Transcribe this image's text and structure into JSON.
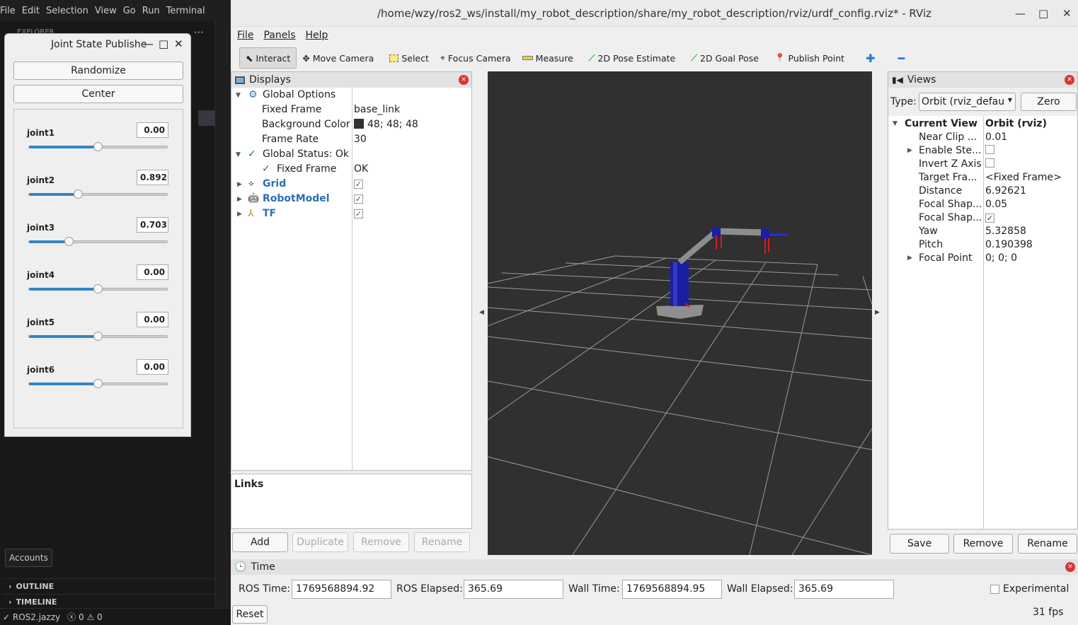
{
  "vscode": {
    "menu": [
      "File",
      "Edit",
      "Selection",
      "View",
      "Go",
      "Run",
      "Terminal"
    ],
    "explorer_label": "EXPLORER",
    "accounts_tooltip": "Accounts",
    "sections": [
      "OUTLINE",
      "TIMELINE"
    ],
    "status": {
      "branch": "ROS2.jazzy",
      "errors": "0",
      "warnings": "0"
    }
  },
  "jsp": {
    "title": "Joint State Publishe",
    "randomize": "Randomize",
    "center": "Center",
    "joints": [
      {
        "name": "joint1",
        "value": "0.00",
        "fraction": 0.5
      },
      {
        "name": "joint2",
        "value": "0.892",
        "fraction": 0.36
      },
      {
        "name": "joint3",
        "value": "0.703",
        "fraction": 0.29
      },
      {
        "name": "joint4",
        "value": "0.00",
        "fraction": 0.5
      },
      {
        "name": "joint5",
        "value": "0.00",
        "fraction": 0.5
      },
      {
        "name": "joint6",
        "value": "0.00",
        "fraction": 0.5
      }
    ]
  },
  "rviz": {
    "title": "/home/wzy/ros2_ws/install/my_robot_description/share/my_robot_description/rviz/urdf_config.rviz* - RViz",
    "menu": [
      "File",
      "Panels",
      "Help"
    ],
    "tools": [
      "Interact",
      "Move Camera",
      "Select",
      "Focus Camera",
      "Measure",
      "2D Pose Estimate",
      "2D Goal Pose",
      "Publish Point"
    ],
    "displays": {
      "title": "Displays",
      "global_options": "Global Options",
      "fixed_frame_label": "Fixed Frame",
      "fixed_frame_value": "base_link",
      "bg_color_label": "Background Color",
      "bg_color_value": "48; 48; 48",
      "frame_rate_label": "Frame Rate",
      "frame_rate_value": "30",
      "global_status": "Global Status: Ok",
      "status_fixed_frame": "Fixed Frame",
      "status_fixed_frame_value": "OK",
      "grid": "Grid",
      "robot_model": "RobotModel",
      "tf": "TF"
    },
    "links_title": "Links",
    "display_buttons": {
      "add": "Add",
      "duplicate": "Duplicate",
      "remove": "Remove",
      "rename": "Rename"
    },
    "views": {
      "title": "Views",
      "type_label": "Type:",
      "type_value": "Orbit (rviz_defau",
      "zero": "Zero",
      "current_view": "Current View",
      "current_view_value": "Orbit (rviz)",
      "props": [
        {
          "name": "Near Clip ...",
          "value": "0.01",
          "kind": "text"
        },
        {
          "name": "Enable Ste...",
          "value": "",
          "kind": "check-off",
          "expand": true
        },
        {
          "name": "Invert Z Axis",
          "value": "",
          "kind": "check-off"
        },
        {
          "name": "Target Fra...",
          "value": "<Fixed Frame>",
          "kind": "text"
        },
        {
          "name": "Distance",
          "value": "6.92621",
          "kind": "text"
        },
        {
          "name": "Focal Shap...",
          "value": "0.05",
          "kind": "text"
        },
        {
          "name": "Focal Shap...",
          "value": "✓",
          "kind": "check-on"
        },
        {
          "name": "Yaw",
          "value": "5.32858",
          "kind": "text"
        },
        {
          "name": "Pitch",
          "value": "0.190398",
          "kind": "text"
        },
        {
          "name": "Focal Point",
          "value": "0; 0; 0",
          "kind": "text",
          "expand": true
        }
      ],
      "buttons": {
        "save": "Save",
        "remove": "Remove",
        "rename": "Rename"
      }
    },
    "time": {
      "title": "Time",
      "ros_time_label": "ROS Time:",
      "ros_time": "1769568894.92",
      "ros_elapsed_label": "ROS Elapsed:",
      "ros_elapsed": "365.69",
      "wall_time_label": "Wall Time:",
      "wall_time": "1769568894.95",
      "wall_elapsed_label": "Wall Elapsed:",
      "wall_elapsed": "365.69",
      "experimental": "Experimental",
      "reset": "Reset",
      "fps": "31 fps"
    }
  }
}
